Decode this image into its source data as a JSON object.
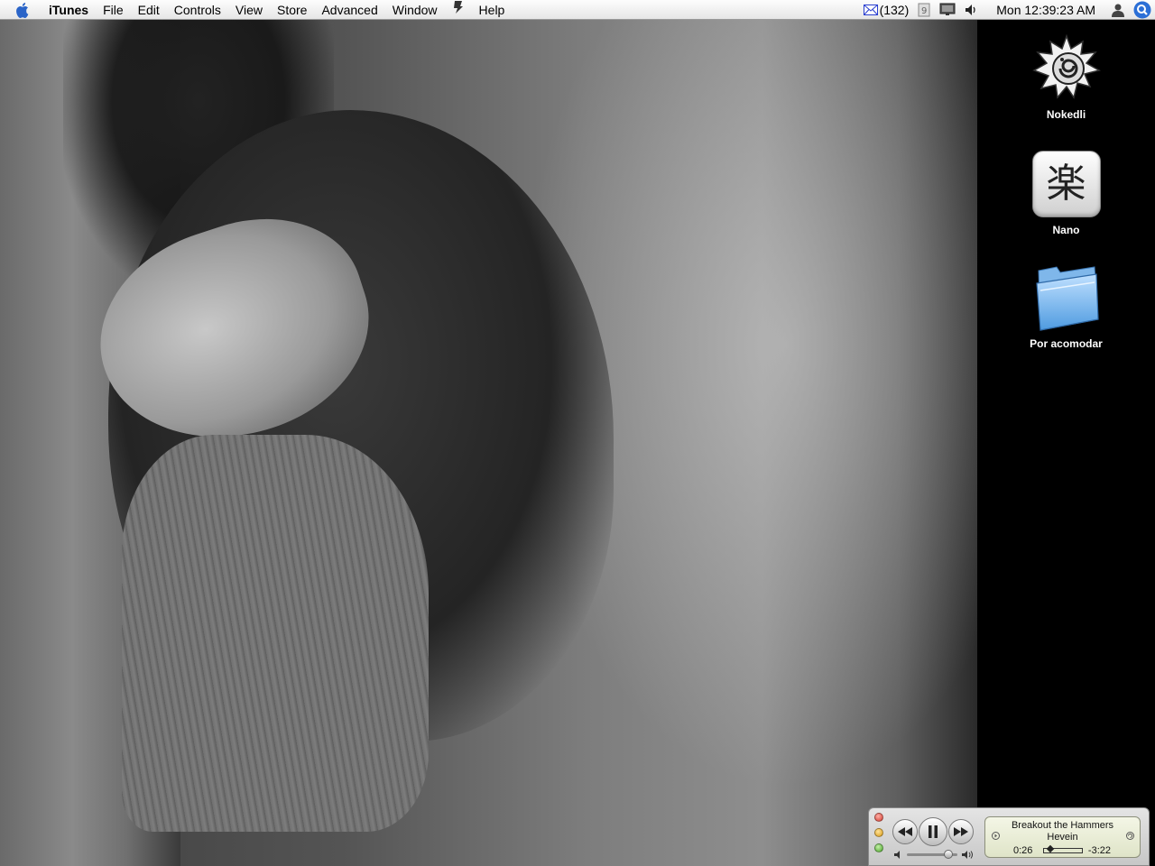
{
  "menubar": {
    "app_name": "iTunes",
    "items": [
      "File",
      "Edit",
      "Controls",
      "View",
      "Store",
      "Advanced",
      "Window",
      "Help"
    ],
    "mail_count": "(132)",
    "clock": "Mon 12:39:23 AM"
  },
  "desktop_icons": [
    {
      "label": "Nokedli",
      "icon": "nokedli-app-icon"
    },
    {
      "label": "Nano",
      "icon": "nano-app-icon"
    },
    {
      "label": "Por acomodar",
      "icon": "folder-icon"
    }
  ],
  "nano_glyph": "楽",
  "mini_player": {
    "track_title": "Breakout the Hammers",
    "artist": "Hevein",
    "elapsed": "0:26",
    "remaining": "-3:22",
    "progress_fraction": 0.12,
    "volume_fraction": 0.9,
    "state": "playing"
  },
  "colors": {
    "menubar_bg": "#f0f0f0",
    "spotlight_blue": "#2b6fd6",
    "lcd_bg": "#e8ecd6"
  }
}
